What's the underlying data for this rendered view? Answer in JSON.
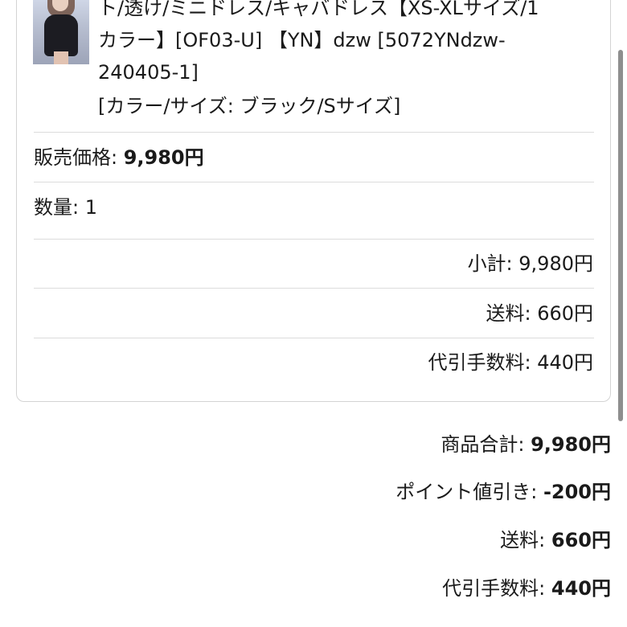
{
  "product": {
    "image_alt": "product-photo",
    "title_lines": [
      "ト/透け/ミニドレス/キャバドレス【XS-XLサイズ/1",
      "カラー】[OF03-U] 【YN】dzw [5072YNdzw-",
      "240405-1]"
    ],
    "variant": "[カラー/サイズ: ブラック/Sサイズ]"
  },
  "item": {
    "price_label": "販売価格: ",
    "price_value": "9,980円",
    "quantity_label": "数量: ",
    "quantity_value": "1",
    "subtotal_label": "小計: ",
    "subtotal_value": "9,980円",
    "shipping_label": "送料: ",
    "shipping_value": "660円",
    "cod_fee_label": "代引手数料: ",
    "cod_fee_value": "440円"
  },
  "summary": {
    "product_total_label": "商品合計: ",
    "product_total_value": "9,980円",
    "points_label": "ポイント値引き: ",
    "points_value": "-200円",
    "shipping_label": "送料: ",
    "shipping_value": "660円",
    "cod_fee_label": "代引手数料: ",
    "cod_fee_value": "440円"
  }
}
